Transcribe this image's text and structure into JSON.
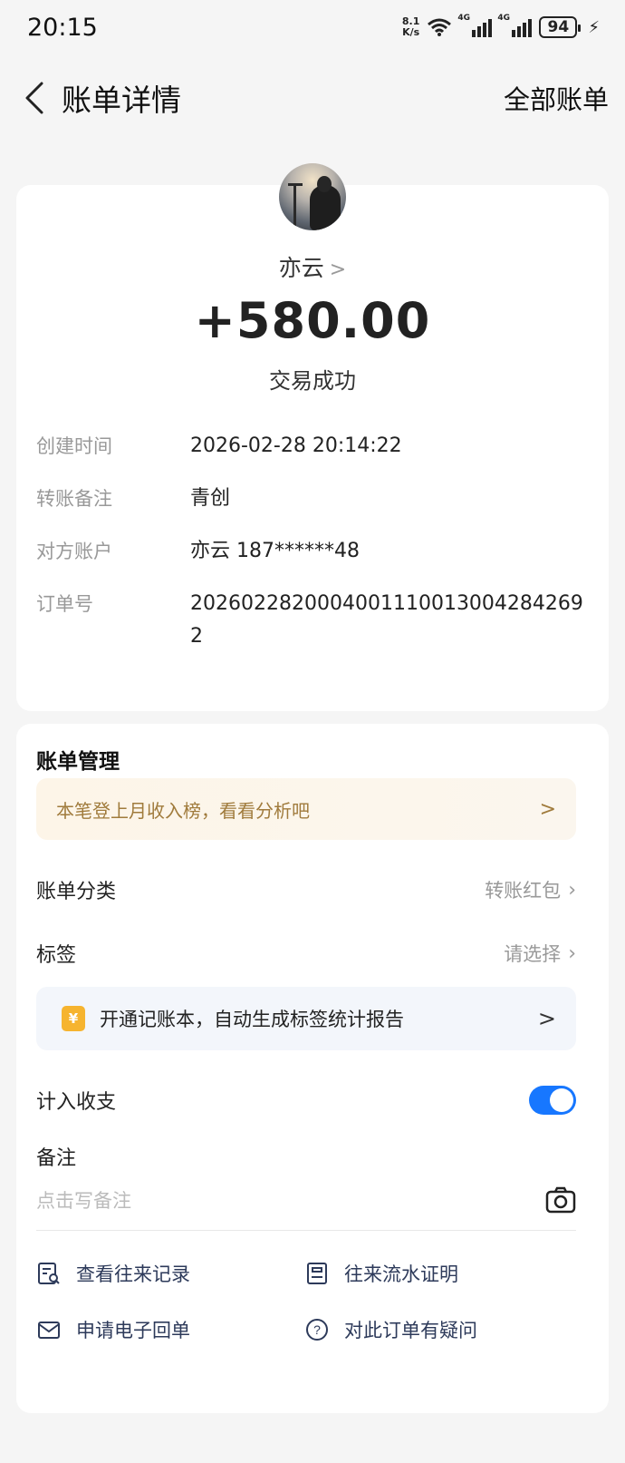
{
  "status_bar": {
    "time": "20:15",
    "net_speed_value": "8.1",
    "net_speed_unit": "K/s",
    "signal_label": "4G",
    "battery": "94",
    "icons": [
      "wifi-icon",
      "signal-4g-icon",
      "signal-4g-icon",
      "battery-icon",
      "charging-icon"
    ]
  },
  "nav": {
    "title": "账单详情",
    "right_action": "全部账单",
    "back_icon": "back-chevron-icon"
  },
  "transaction": {
    "payee_name": "亦云",
    "chevron": ">",
    "amount": "+580.00",
    "status": "交易成功",
    "details": [
      {
        "key": "创建时间",
        "value": "2026-02-28 20:14:22"
      },
      {
        "key": "转账备注",
        "value": "青创"
      },
      {
        "key": "对方账户",
        "value": "亦云 187******48"
      },
      {
        "key": "订单号",
        "value": "2026022820004001110013004284269 2"
      }
    ]
  },
  "management": {
    "title": "账单管理",
    "promo_text": "本笔登上月收入榜，看看分析吧",
    "promo_arrow": ">",
    "category_label": "账单分类",
    "category_value": "转账红包",
    "tag_label": "标签",
    "tag_value": "请选择",
    "ledger_icon_char": "¥",
    "ledger_text": "开通记账本，自动生成标签统计报告",
    "ledger_arrow": ">",
    "include_label": "计入收支",
    "include_enabled": true,
    "remark_label": "备注",
    "remark_placeholder": "点击写备注",
    "actions": [
      {
        "label": "查看往来记录",
        "icon": "record-search-icon"
      },
      {
        "label": "往来流水证明",
        "icon": "statement-icon"
      },
      {
        "label": "申请电子回单",
        "icon": "mail-icon"
      },
      {
        "label": "对此订单有疑问",
        "icon": "question-icon"
      }
    ]
  },
  "colors": {
    "accent": "#1777ff",
    "promo_text": "#a07b3c",
    "yen_icon": "#f6b42f",
    "action_text": "#2d3a5a"
  }
}
